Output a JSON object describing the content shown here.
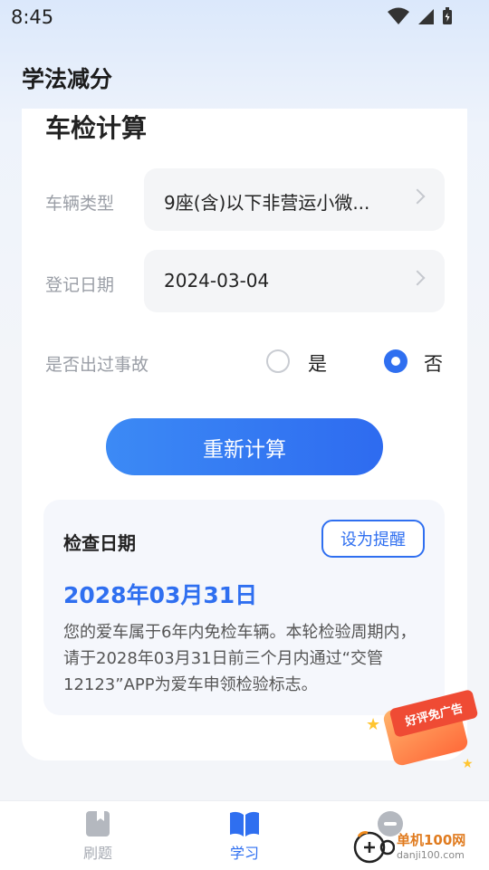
{
  "status_bar": {
    "time": "8:45"
  },
  "app_bar": {
    "title": "学法减分"
  },
  "form": {
    "title": "车检计算",
    "vehicle_type": {
      "label": "车辆类型",
      "value": "9座(含)以下非营运小微..."
    },
    "register_date": {
      "label": "登记日期",
      "value": "2024-03-04"
    },
    "accident": {
      "label": "是否出过事故",
      "options": [
        "是",
        "否"
      ],
      "selected": "否"
    },
    "recalc_button": "重新计算"
  },
  "result": {
    "title": "检查日期",
    "remind_button": "设为提醒",
    "date": "2028年03月31日",
    "description": "您的爱车属于6年内免检车辆。本轮检验周期内，请于2028年03月31日前三个月内通过“交管12123”APP为爱车申领检验标志。"
  },
  "ad_badge": {
    "label": "好评免广告"
  },
  "bottom_nav": {
    "items": [
      {
        "label": "刷题",
        "icon": "bookmark-book-icon",
        "active": false
      },
      {
        "label": "学习",
        "icon": "open-book-icon",
        "active": true
      },
      {
        "label": "",
        "icon": "profile-icon",
        "active": false
      }
    ]
  },
  "watermark": {
    "line1": "单机100网",
    "line2": "danji100.com"
  },
  "colors": {
    "accent": "#2f6ff0",
    "inactive_nav": "#a8acb4",
    "ad_red": "#ef4b34"
  }
}
